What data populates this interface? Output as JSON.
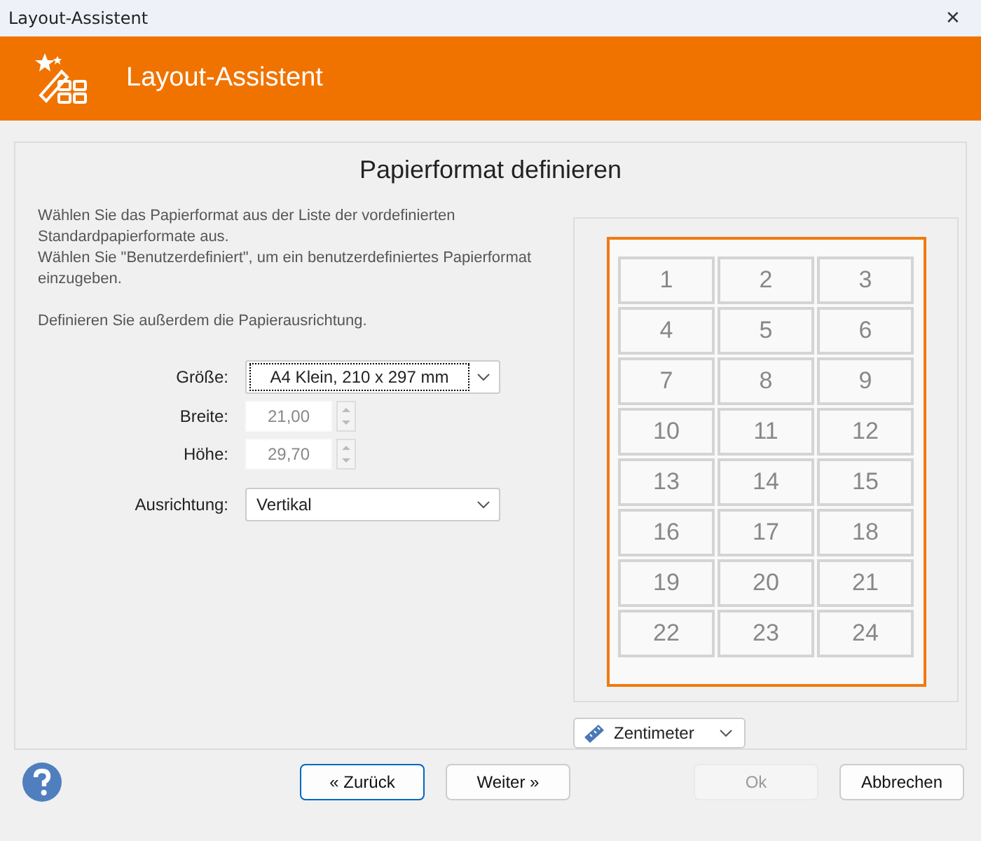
{
  "window": {
    "title": "Layout-Assistent",
    "close": "✕"
  },
  "header": {
    "title": "Layout-Assistent"
  },
  "page": {
    "heading": "Papierformat definieren",
    "intro": [
      "Wählen Sie das Papierformat aus der Liste der vordefinierten Standardpapierformate aus.",
      "Wählen Sie \"Benutzerdefiniert\", um ein benutzerdefiniertes Papierformat einzugeben.",
      "Definieren Sie außerdem die Papierausrichtung."
    ],
    "fields": [
      {
        "kind": "dropdown",
        "label": "Größe:",
        "value": "A4 Klein, 210 x 297 mm",
        "focused": true,
        "disabled": false
      },
      {
        "kind": "spinner",
        "label": "Breite:",
        "value": "21,00",
        "focused": false,
        "disabled": true
      },
      {
        "kind": "spinner",
        "label": "Höhe:",
        "value": "29,70",
        "focused": false,
        "disabled": true
      },
      {
        "kind": "dropdown",
        "label": "Ausrichtung:",
        "value": "Vertikal",
        "focused": false,
        "disabled": false
      }
    ],
    "labels": [
      "1",
      "2",
      "3",
      "4",
      "5",
      "6",
      "7",
      "8",
      "9",
      "10",
      "11",
      "12",
      "13",
      "14",
      "15",
      "16",
      "17",
      "18",
      "19",
      "20",
      "21",
      "22",
      "23",
      "24"
    ],
    "unit": "Zentimeter"
  },
  "buttons": [
    {
      "label": "« Zurück",
      "focused": true,
      "disabled": false
    },
    {
      "label": "Weiter »",
      "focused": false,
      "disabled": false
    },
    {
      "label": "Ok",
      "focused": false,
      "disabled": true
    },
    {
      "label": "Abbrechen",
      "focused": false,
      "disabled": false
    }
  ]
}
